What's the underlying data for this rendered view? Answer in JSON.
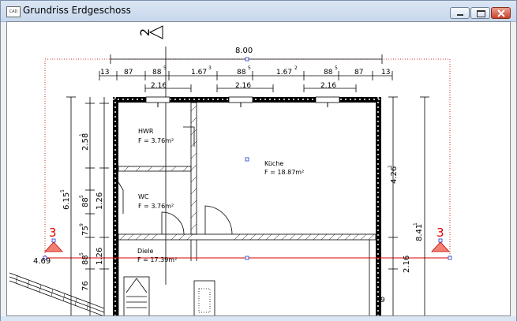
{
  "window": {
    "title": "Grundriss Erdgeschoss",
    "app_icon_label": "CAD",
    "accent_color": "#cc0000"
  },
  "drawing": {
    "section_label": "2",
    "section_marker_left": "3",
    "section_marker_right": "3",
    "top_total": "8.00",
    "top_dims": [
      "13",
      "87",
      "88",
      "5",
      "1.67",
      "3",
      "88",
      "5",
      "1.67",
      "2",
      "88",
      "5",
      "87",
      "13"
    ],
    "top_dims2": [
      "2.16",
      "2.16",
      "2.16"
    ],
    "left_dims_outer": [
      "6.15",
      "5"
    ],
    "left_dims": [
      "2.58",
      "1",
      "1.26",
      "88",
      "5",
      "75",
      "9",
      "1.26",
      "88",
      "5",
      "76"
    ],
    "right_dims": [
      "4.26",
      "1",
      "8.41",
      "1",
      "2.16"
    ],
    "left_offset_label": "4.69",
    "right_offset_label": "9",
    "rooms": [
      {
        "name": "HWR",
        "area": "F = 3.76m²"
      },
      {
        "name": "WC",
        "area": "F = 3.76m²"
      },
      {
        "name": "Küche",
        "area": "F = 18.87m²"
      },
      {
        "name": "Diele",
        "area": "F = 17.39m²"
      }
    ]
  }
}
